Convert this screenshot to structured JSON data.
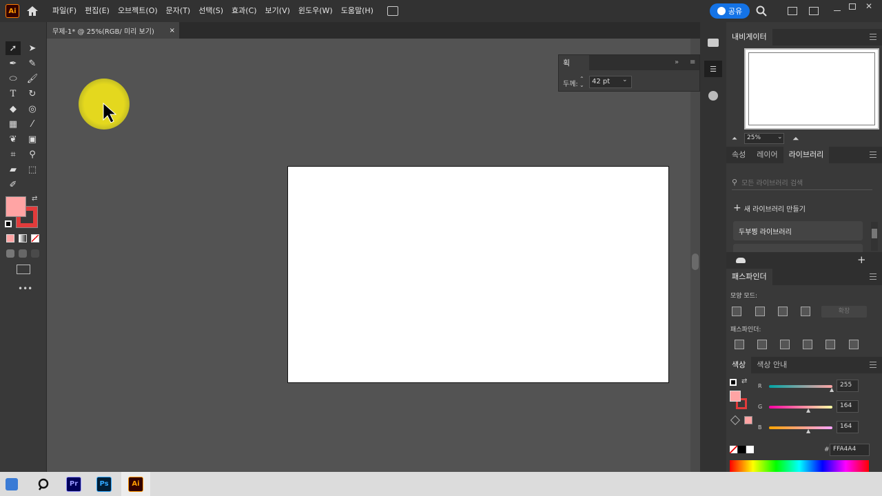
{
  "app": {
    "logo": "Ai"
  },
  "menubar": {
    "items": [
      "파일(F)",
      "편집(E)",
      "오브젝트(O)",
      "문자(T)",
      "선택(S)",
      "효과(C)",
      "보기(V)",
      "윈도우(W)",
      "도움말(H)"
    ],
    "share_label": "공유"
  },
  "document": {
    "tab_title": "무제-1* @ 25%(RGB/ 미리 보기)"
  },
  "stroke_panel": {
    "title": "획",
    "weight_label": "두께:",
    "weight_value": "42 pt"
  },
  "navigator": {
    "title": "내비게이터",
    "zoom": "25%"
  },
  "properties_tabs": {
    "tabs": [
      "속성",
      "레이어",
      "라이브러리"
    ],
    "active": "라이브러리"
  },
  "library": {
    "search_placeholder": "모든 라이브러리 검색",
    "new_library": "새 라이브러리 만들기",
    "items": [
      "두부찡 라이브러리"
    ]
  },
  "pathfinder": {
    "title": "패스파인더",
    "shape_modes": "모양 모드:",
    "expand": "확장",
    "pathfinders": "패스파인더:"
  },
  "color_panel": {
    "tabs": [
      "색상",
      "색상 안내"
    ],
    "r": "255",
    "g": "164",
    "b": "164",
    "hex_label": "#",
    "hex": "FFA4A4",
    "channel_r": "R",
    "channel_g": "G",
    "channel_b": "B"
  },
  "colors": {
    "fill": "#ffa4a4",
    "stroke": "#e23b3b",
    "accent": "#1473e6",
    "highlight": "#e4d81e"
  },
  "taskbar": {
    "apps": [
      "Pr",
      "Ps",
      "Ai"
    ]
  }
}
